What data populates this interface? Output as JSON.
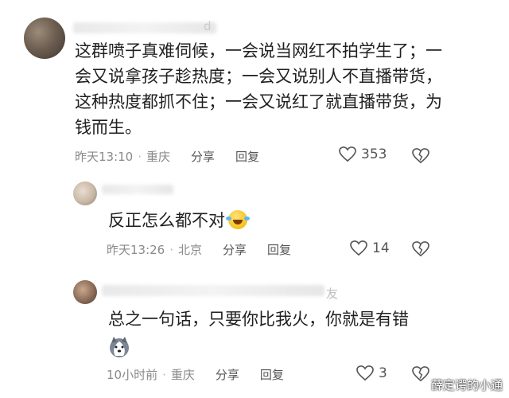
{
  "main_comment": {
    "text": "这群喷子真难伺候，一会说当网红不拍学生了；一会又说拿孩子趁热度；一会又说别人不直播带货，这种热度都抓不住；一会又说红了就直播带货，为钱而生。",
    "time": "昨天13:10",
    "location": "重庆",
    "share_label": "分享",
    "reply_label": "回复",
    "likes": "353"
  },
  "replies": [
    {
      "text": "反正怎么都不对",
      "time": "昨天13:26",
      "location": "北京",
      "share_label": "分享",
      "reply_label": "回复",
      "likes": "14"
    },
    {
      "name_tail": "友",
      "text": "总之一句话，只要你比我火，你就是有错",
      "time": "10小时前",
      "location": "重庆",
      "share_label": "分享",
      "reply_label": "回复",
      "likes": "3"
    }
  ],
  "watermark": "薛定谔的小通"
}
